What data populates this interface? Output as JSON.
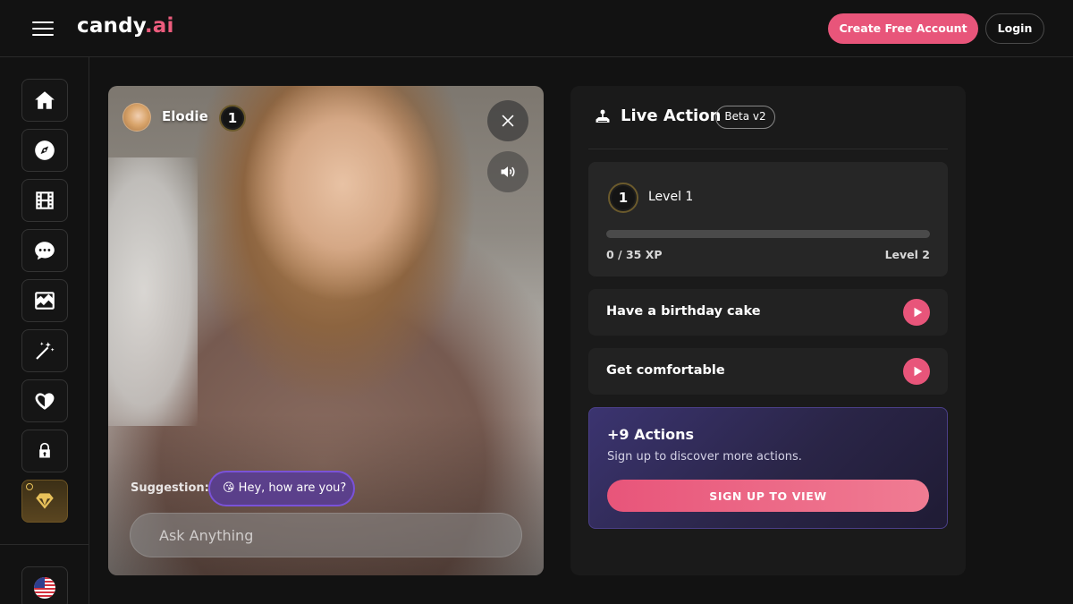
{
  "header": {
    "logo_main": "candy",
    "logo_suffix": ".ai",
    "create_account_label": "Create Free Account",
    "login_label": "Login"
  },
  "sidebar": {
    "items": [
      {
        "icon": "home-icon"
      },
      {
        "icon": "compass-icon"
      },
      {
        "icon": "film-icon"
      },
      {
        "icon": "chat-bubble-icon"
      },
      {
        "icon": "image-icon"
      },
      {
        "icon": "magic-wand-icon"
      },
      {
        "icon": "heart-icon"
      },
      {
        "icon": "lock-icon"
      },
      {
        "icon": "diamond-icon"
      }
    ],
    "language_icon": "us-flag-icon"
  },
  "chat": {
    "character_name": "Elodie",
    "character_level": "1",
    "suggestion_label": "Suggestion:",
    "suggestion_text": "😘 Hey, how are you?",
    "input_placeholder": "Ask Anything"
  },
  "live_action": {
    "title": "Live Action",
    "beta_tag": "Beta v2",
    "level_badge": "1",
    "level_label": "Level 1",
    "xp_text": "0 / 35 XP",
    "next_level": "Level 2",
    "xp_progress": 0,
    "actions": [
      {
        "label": "Have a birthday cake"
      },
      {
        "label": "Get comfortable"
      }
    ],
    "promo_title": "+9 Actions",
    "promo_subtitle": "Sign up to discover more actions.",
    "promo_button": "SIGN UP TO VIEW"
  },
  "colors": {
    "accent": "#e8557a",
    "background": "#121212",
    "panel": "#1a1a1a",
    "promo_border": "#4b3f88"
  }
}
